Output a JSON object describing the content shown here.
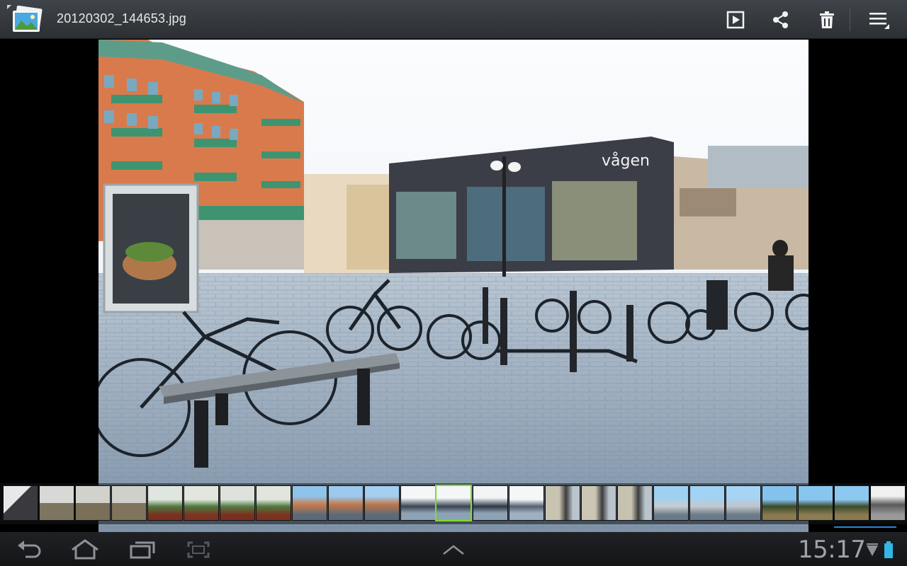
{
  "header": {
    "title": "20120302_144653.jpg",
    "app_icon": "gallery-app-icon",
    "actions": [
      {
        "name": "slideshow",
        "icon": "play-icon"
      },
      {
        "name": "share",
        "icon": "share-icon"
      },
      {
        "name": "delete",
        "icon": "trash-icon"
      },
      {
        "name": "menu",
        "icon": "overflow-menu-icon"
      }
    ]
  },
  "filmstrip": {
    "thumbnail_count": 25,
    "selected_index": 12,
    "selection_color": "#7fdc2a",
    "scroll_indicator_color": "#2d86d6"
  },
  "system_bar": {
    "nav": [
      {
        "name": "back",
        "icon": "back-icon"
      },
      {
        "name": "home",
        "icon": "home-icon"
      },
      {
        "name": "recent",
        "icon": "recent-apps-icon"
      },
      {
        "name": "screenshot",
        "icon": "screenshot-icon"
      }
    ],
    "center_icon": "chevron-up-icon",
    "time": "15:17",
    "status_icons": [
      "wifi-icon",
      "battery-icon"
    ],
    "accent": "#33b5e5"
  }
}
